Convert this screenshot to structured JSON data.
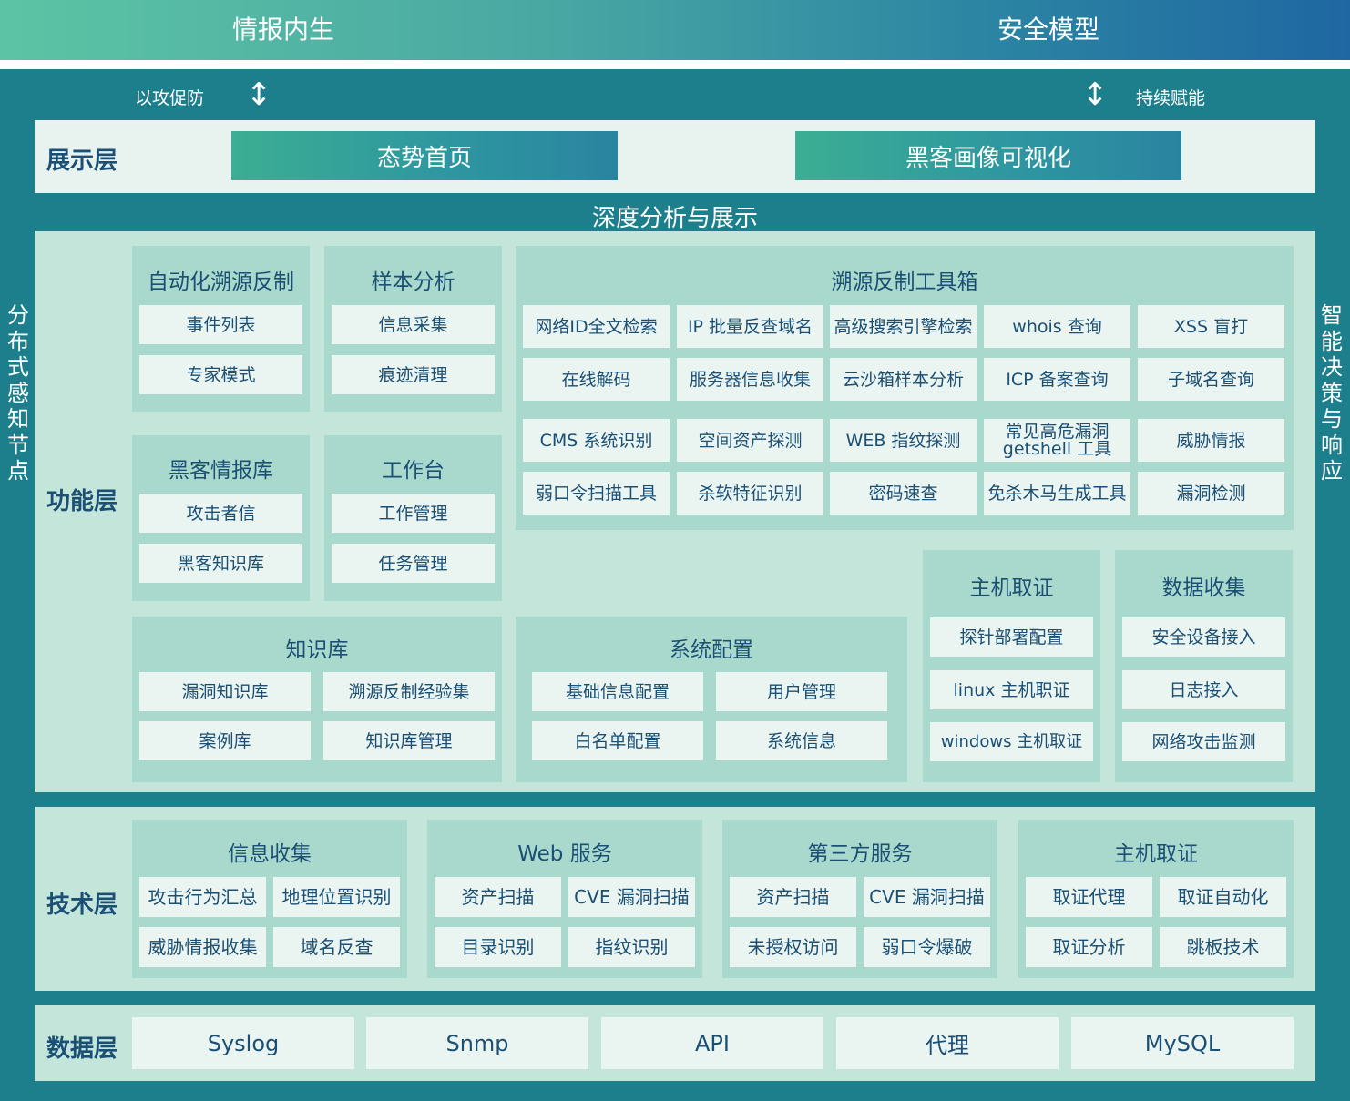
{
  "header": {
    "left": "情报内生",
    "right": "安全模型"
  },
  "flow": {
    "left": "以攻促防",
    "right": "持续赋能",
    "arrow": "↕"
  },
  "sides": {
    "left": "分布式感知节点",
    "right": "智能决策与响应"
  },
  "presentation": {
    "label": "展示层",
    "box1": "态势首页",
    "box2": "黑客画像可视化",
    "band": "深度分析与展示"
  },
  "function": {
    "label": "功能层",
    "auto_trace": {
      "title": "自动化溯源反制",
      "items": [
        "事件列表",
        "专家模式"
      ]
    },
    "sample": {
      "title": "样本分析",
      "items": [
        "信息采集",
        "痕迹清理"
      ]
    },
    "hacker_db": {
      "title": "黑客情报库",
      "items": [
        "攻击者信",
        "黑客知识库"
      ]
    },
    "workbench": {
      "title": "工作台",
      "items": [
        "工作管理",
        "任务管理"
      ]
    },
    "toolbox": {
      "title": "溯源反制工具箱",
      "items": [
        "网络ID全文检索",
        "IP 批量反查域名",
        "高级搜索引擎检索",
        "whois 查询",
        "XSS 盲打",
        "在线解码",
        "服务器信息收集",
        "云沙箱样本分析",
        "ICP 备案查询",
        "子域名查询",
        "CMS 系统识别",
        "空间资产探测",
        "WEB 指纹探测",
        "常见高危漏洞\ngetshell 工具",
        "威胁情报",
        "弱口令扫描工具",
        "杀软特征识别",
        "密码速查",
        "免杀木马生成工具",
        "漏洞检测"
      ]
    },
    "knowledge": {
      "title": "知识库",
      "items": [
        "漏洞知识库",
        "溯源反制经验集",
        "案例库",
        "知识库管理"
      ]
    },
    "sysconfig": {
      "title": "系统配置",
      "items": [
        "基础信息配置",
        "用户管理",
        "白名单配置",
        "系统信息"
      ]
    },
    "host_forensics": {
      "title": "主机取证",
      "items": [
        "探针部署配置",
        "linux 主机职证",
        "windows 主机取证"
      ]
    },
    "data_collect": {
      "title": "数据收集",
      "items": [
        "安全设备接入",
        "日志接入",
        "网络攻击监测"
      ]
    }
  },
  "tech": {
    "label": "技术层",
    "groups": [
      {
        "title": "信息收集",
        "items": [
          "攻击行为汇总",
          "地理位置识别",
          "威胁情报收集",
          "域名反查"
        ]
      },
      {
        "title": "Web 服务",
        "items": [
          "资产扫描",
          "CVE 漏洞扫描",
          "目录识别",
          "指纹识别"
        ]
      },
      {
        "title": "第三方服务",
        "items": [
          "资产扫描",
          "CVE 漏洞扫描",
          "未授权访问",
          "弱口令爆破"
        ]
      },
      {
        "title": "主机取证",
        "items": [
          "取证代理",
          "取证自动化",
          "取证分析",
          "跳板技术"
        ]
      }
    ]
  },
  "data_layer": {
    "label": "数据层",
    "items": [
      "Syslog",
      "Snmp",
      "API",
      "代理",
      "MySQL"
    ]
  }
}
